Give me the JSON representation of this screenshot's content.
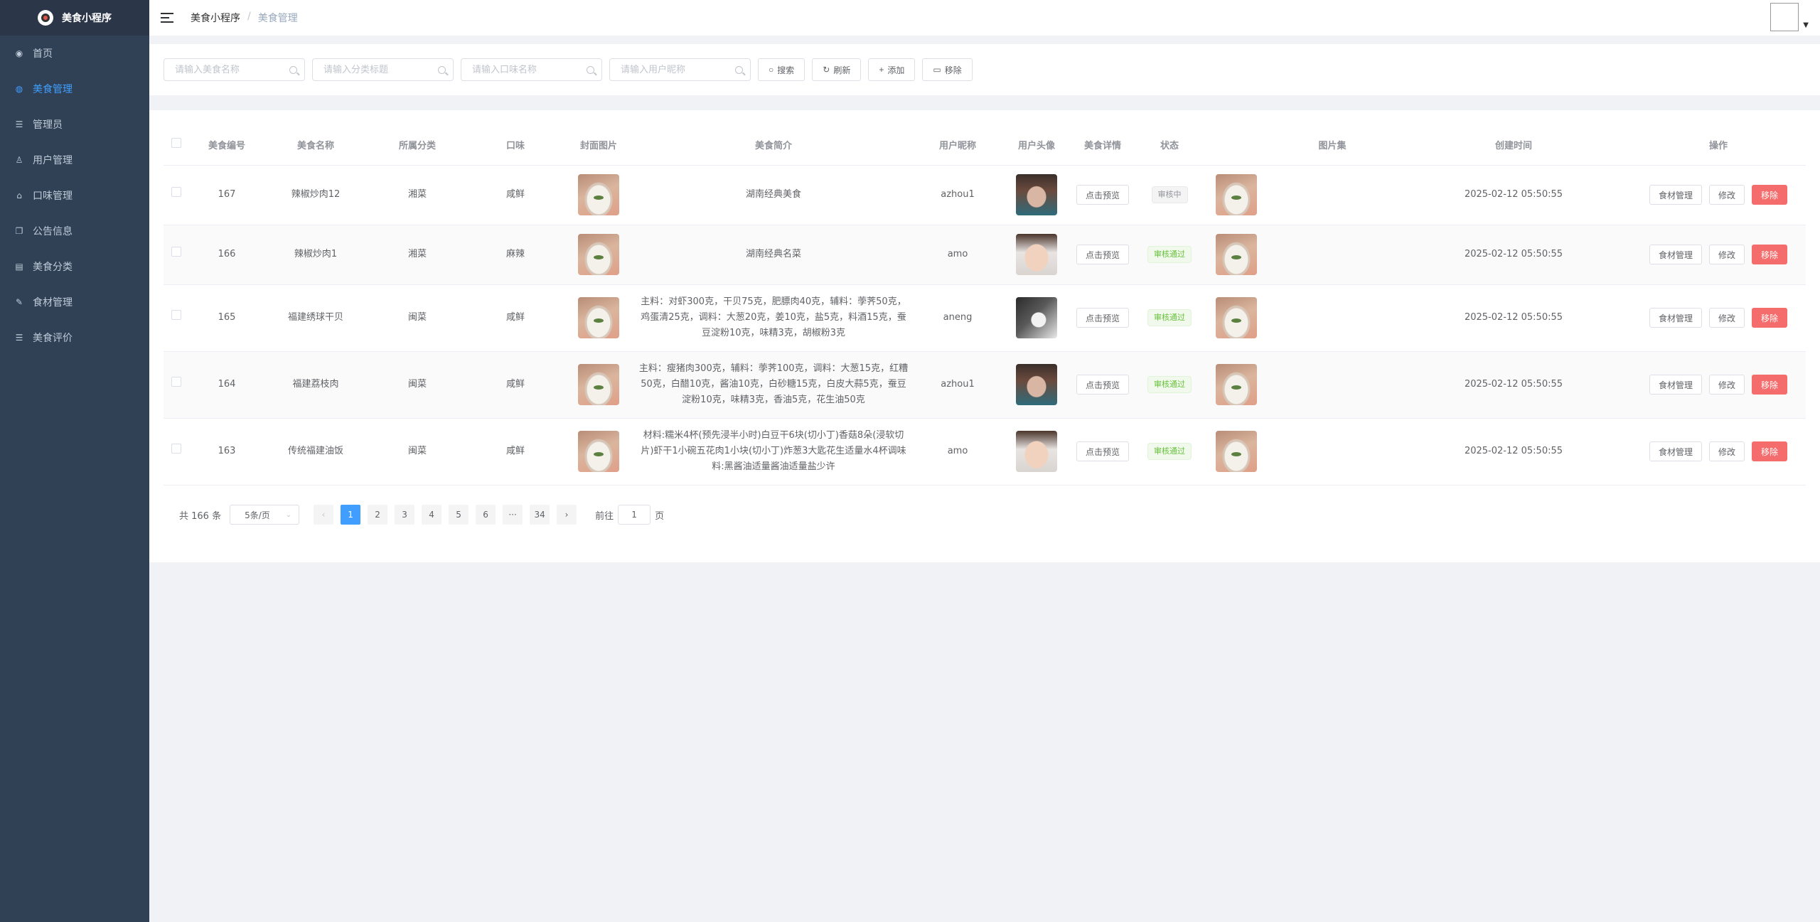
{
  "app": {
    "title": "美食小程序"
  },
  "sidebar": {
    "items": [
      {
        "label": "首页",
        "icon": "dashboard-icon",
        "glyph": "◉"
      },
      {
        "label": "美食管理",
        "icon": "food-icon",
        "glyph": "◍",
        "active": true
      },
      {
        "label": "管理员",
        "icon": "admin-icon",
        "glyph": "☰"
      },
      {
        "label": "用户管理",
        "icon": "user-icon",
        "glyph": "♙"
      },
      {
        "label": "口味管理",
        "icon": "flavor-icon",
        "glyph": "⌂"
      },
      {
        "label": "公告信息",
        "icon": "notice-icon",
        "glyph": "❐"
      },
      {
        "label": "美食分类",
        "icon": "category-icon",
        "glyph": "▤"
      },
      {
        "label": "食材管理",
        "icon": "ingredient-icon",
        "glyph": "✎"
      },
      {
        "label": "美食评价",
        "icon": "review-icon",
        "glyph": "☰"
      }
    ]
  },
  "header": {
    "breadcrumb": [
      "美食小程序",
      "美食管理"
    ],
    "separator": "/"
  },
  "search": {
    "food_name_placeholder": "请输入美食名称",
    "category_placeholder": "请输入分类标题",
    "flavor_placeholder": "请输入口味名称",
    "nickname_placeholder": "请输入用户昵称",
    "buttons": {
      "search": "搜索",
      "refresh": "刷新",
      "add": "添加",
      "remove": "移除"
    }
  },
  "table": {
    "columns": {
      "id": "美食编号",
      "name": "美食名称",
      "category": "所属分类",
      "flavor": "口味",
      "cover": "封面图片",
      "intro": "美食简介",
      "nickname": "用户昵称",
      "avatar": "用户头像",
      "detail": "美食详情",
      "status": "状态",
      "gallery": "图片集",
      "created": "创建时间",
      "ops": "操作"
    },
    "action_labels": {
      "preview": "点击预览",
      "ingredients": "食材管理",
      "edit": "修改",
      "delete": "移除"
    },
    "rows": [
      {
        "id": "167",
        "name": "辣椒炒肉12",
        "category": "湘菜",
        "flavor": "咸鲜",
        "intro": "湖南经典美食",
        "nickname": "azhou1",
        "avatar": "woman",
        "status": "审核中",
        "status_type": "info",
        "created": "2025-02-12 05:50:55"
      },
      {
        "id": "166",
        "name": "辣椒炒肉1",
        "category": "湘菜",
        "flavor": "麻辣",
        "intro": "湖南经典名菜",
        "nickname": "amo",
        "avatar": "baby",
        "status": "审核通过",
        "status_type": "success",
        "created": "2025-02-12 05:50:55"
      },
      {
        "id": "165",
        "name": "福建绣球干贝",
        "category": "闽菜",
        "flavor": "咸鲜",
        "intro": "主料：对虾300克，干贝75克，肥膘肉40克，辅料：荸荠50克，鸡蛋清25克，调料：大葱20克，姜10克，盐5克，料酒15克，蚕豆淀粉10克，味精3克，胡椒粉3克",
        "nickname": "aneng",
        "avatar": "dog",
        "status": "审核通过",
        "status_type": "success",
        "created": "2025-02-12 05:50:55"
      },
      {
        "id": "164",
        "name": "福建荔枝肉",
        "category": "闽菜",
        "flavor": "咸鲜",
        "intro": "主料：瘦猪肉300克，辅料：荸荠100克，调料：大葱15克，红糟50克，白醋10克，酱油10克，白砂糖15克，白皮大蒜5克，蚕豆淀粉10克，味精3克，香油5克，花生油50克",
        "nickname": "azhou1",
        "avatar": "woman",
        "status": "审核通过",
        "status_type": "success",
        "created": "2025-02-12 05:50:55"
      },
      {
        "id": "163",
        "name": "传统福建油饭",
        "category": "闽菜",
        "flavor": "咸鲜",
        "intro": "材料:糯米4杯(预先浸半小时)白豆干6块(切小丁)香菇8朵(浸软切片)虾干1小碗五花肉1小块(切小丁)炸葱3大匙花生适量水4杯调味料:黑酱油适量酱油适量盐少许",
        "nickname": "amo",
        "avatar": "baby",
        "status": "审核通过",
        "status_type": "success",
        "created": "2025-02-12 05:50:55"
      }
    ]
  },
  "pagination": {
    "total_text": "共 166 条",
    "page_size": "5条/页",
    "pages": [
      "1",
      "2",
      "3",
      "4",
      "5",
      "6",
      "···",
      "34"
    ],
    "current": "1",
    "goto_label": "前往",
    "goto_value": "1",
    "page_suffix": "页"
  },
  "colors": {
    "sidebar": "#304156",
    "accent": "#409eff",
    "danger": "#f56c6c",
    "success": "#67c23a"
  }
}
